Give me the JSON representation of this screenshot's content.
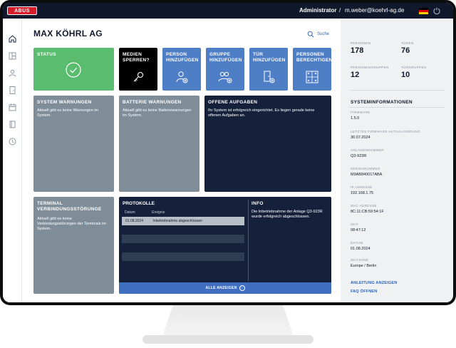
{
  "topbar": {
    "logo": "ABUS",
    "role": "Administrator",
    "separator": "/",
    "email": "m.weber@koehrl-ag.de",
    "flag_colors": [
      "#000000",
      "#dd0000",
      "#ffce00"
    ]
  },
  "rail": {
    "items": [
      "home-icon",
      "layout-icon",
      "user-icon",
      "door-icon",
      "calendar-icon",
      "book-icon",
      "clock-icon"
    ]
  },
  "main": {
    "title": "MAX KÖHRL AG",
    "search_label": "Suche",
    "tiles": {
      "status": "STATUS",
      "medien": "MEDIEN SPERREN?",
      "person": "PERSON HINZUFÜGEN",
      "gruppe": "GRUPPE HINZUFÜGEN",
      "tuer": "TÜR HINZUFÜGEN",
      "berechtigen": "PERSONEN BERECHTIGEN",
      "system_warn_title": "SYSTEM WARNUNGEN",
      "system_warn_text": "Aktuell gibt es keine Warnungen im System.",
      "batterie_title": "BATTERIE WARNUNGEN",
      "batterie_text": "Aktuell gibt es keine Batteriewarnungen im System.",
      "aufgaben_title": "OFFENE AUFGABEN",
      "aufgaben_text": "Ihr System ist erfolgreich eingerichtet. Es liegen gerade keine offenen Aufgaben an.",
      "terminal_title": "TERMINAL VERBINDUNGSSTÖRUNGE",
      "terminal_text": "Aktuell gibt es keine Verbindungsstörungen der Terminals im System.",
      "info_title": "INFO",
      "info_text": "Die Inbetriebnahme der Anlage Q3-923R wurde erfolgreich abgeschlossen."
    },
    "protokolle": {
      "title": "PROTOKOLLE",
      "col_date": "Datum",
      "col_event": "Ereignis",
      "rows": [
        {
          "date": "01.08.2024",
          "event": "Inbetriebnahme abgeschlossen"
        }
      ],
      "button_label": "ALLE ANZEIGEN",
      "button_icon": "↑"
    }
  },
  "side": {
    "stats": [
      {
        "label": "PERSONEN",
        "value": "178"
      },
      {
        "label": "TÜREN",
        "value": "76"
      },
      {
        "label": "PERSONENGRUPPEN",
        "value": "12"
      },
      {
        "label": "TÜRGRUPPEN",
        "value": "10"
      }
    ],
    "sys_title": "SYSTEMINFORMATIONEN",
    "sys": [
      {
        "label": "FIRMWARE",
        "value": "1.5.0"
      },
      {
        "label": "LETZTES FIRMWARE AKTUALISIERUNG",
        "value": "30.07.2024"
      },
      {
        "label": "ANLAGENNUMMER",
        "value": "Q3-923R"
      },
      {
        "label": "SERIENNUMMER",
        "value": "M9AB840017ABA"
      },
      {
        "label": "IP ADRESSE",
        "value": "192.168.1.75"
      },
      {
        "label": "MAC ADRESSE",
        "value": "8C:11:CB:59:54:1F"
      },
      {
        "label": "ZEIT",
        "value": "08:47:12"
      },
      {
        "label": "DATUM",
        "value": "01.08.2024"
      },
      {
        "label": "ZEITZONE",
        "value": "Europe / Berlin"
      }
    ],
    "links": [
      "ANLEITUNG ANZEIGEN",
      "FAQ ÖFFNEN"
    ]
  }
}
